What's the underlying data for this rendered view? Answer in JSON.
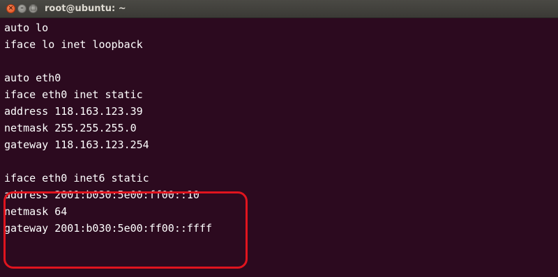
{
  "window": {
    "title": "root@ubuntu: ~",
    "close_glyph": "×",
    "minimize_glyph": "–",
    "maximize_glyph": "□"
  },
  "terminal": {
    "lines": [
      "auto lo",
      "iface lo inet loopback",
      "",
      "auto eth0",
      "iface eth0 inet static",
      "address 118.163.123.39",
      "netmask 255.255.255.0",
      "gateway 118.163.123.254",
      "",
      "iface eth0 inet6 static",
      "address 2001:b030:5e00:ff00::10",
      "netmask 64",
      "gateway 2001:b030:5e00:ff00::ffff"
    ]
  },
  "colors": {
    "terminal_background": "#2c0a1f",
    "terminal_text": "#ffffff",
    "highlight_border": "#e0141e",
    "close_button": "#df4a16"
  }
}
